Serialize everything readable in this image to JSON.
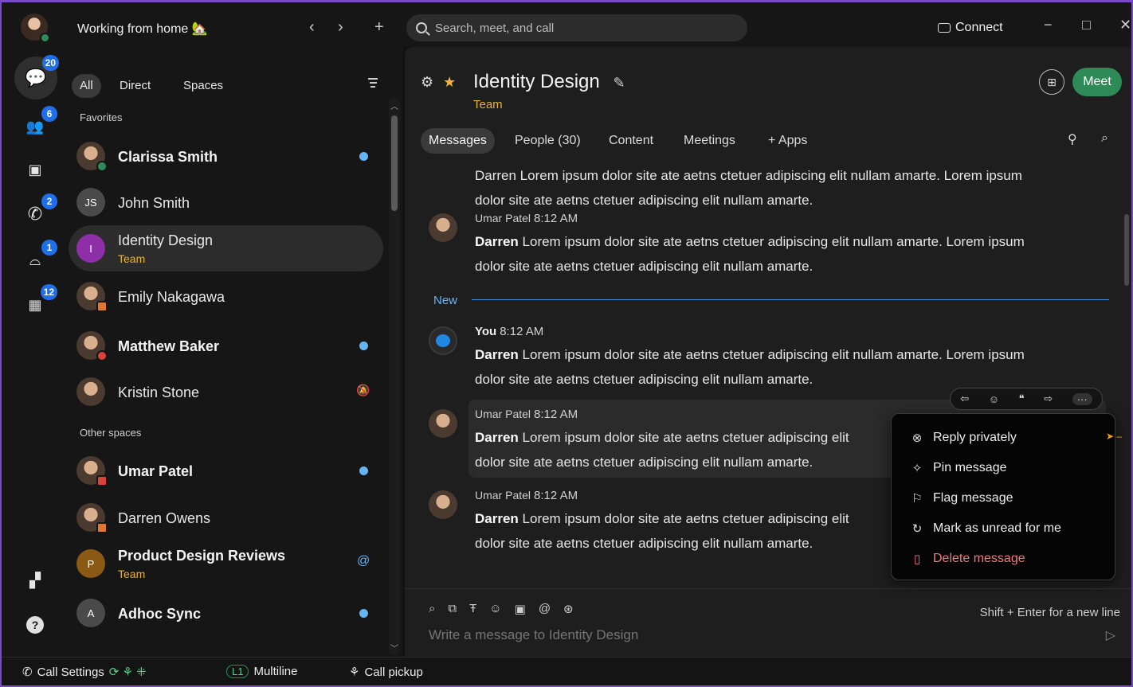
{
  "titlebar": {
    "status": "Working from home 🏡",
    "back": "‹",
    "forward": "›",
    "new": "+",
    "search_placeholder": "Search, meet, and call",
    "connect": "Connect",
    "minimize": "−",
    "maximize": "□",
    "close": "✕"
  },
  "rail": {
    "messaging_badge": "20",
    "teams_badge": "6",
    "calls_badge": "2",
    "voicemail_badge": "1",
    "meetings_badge": "12",
    "help": "?"
  },
  "list": {
    "filters": [
      "All",
      "Direct",
      "Spaces"
    ],
    "section_favorites": "Favorites",
    "section_other": "Other spaces",
    "items": [
      {
        "name": "Clarissa Smith",
        "initials": ""
      },
      {
        "name": "John Smith",
        "initials": "JS"
      },
      {
        "name": "Identity Design",
        "initials": "I",
        "sub": "Team"
      },
      {
        "name": "Emily Nakagawa",
        "initials": ""
      },
      {
        "name": "Matthew Baker",
        "initials": ""
      },
      {
        "name": "Kristin Stone",
        "initials": ""
      },
      {
        "name": "Umar Patel",
        "initials": ""
      },
      {
        "name": "Darren Owens",
        "initials": ""
      },
      {
        "name": "Product Design Reviews",
        "initials": "P",
        "sub": "Team"
      },
      {
        "name": "Adhoc Sync",
        "initials": "A"
      }
    ]
  },
  "space": {
    "title": "Identity Design",
    "subtitle": "Team",
    "meet": "Meet",
    "tabs": [
      "Messages",
      "People (30)",
      "Content",
      "Meetings",
      "+ Apps"
    ]
  },
  "messages": {
    "first_tail": "dolor site ate aetns ctetuer adipiscing elit nullam amarte.",
    "first_head": "Darren Lorem ipsum dolor site ate aetns ctetuer adipiscing elit nullam amarte. Lorem ipsum",
    "new_label": "New",
    "items": [
      {
        "sender": "Umar Patel",
        "time": "8:12 AM",
        "mention": "Darren",
        "line1": " Lorem ipsum dolor site ate aetns ctetuer adipiscing elit nullam amarte. Lorem ipsum",
        "line2": "dolor site ate aetns ctetuer adipiscing elit nullam amarte."
      },
      {
        "sender": "You",
        "time": "8:12 AM",
        "mention": "Darren",
        "line1": " Lorem ipsum dolor site ate aetns ctetuer adipiscing elit nullam amarte. Lorem ipsum",
        "line2": "dolor site ate aetns ctetuer adipiscing elit nullam amarte."
      },
      {
        "sender": "Umar Patel",
        "time": "8:12 AM",
        "mention": "Darren",
        "line1": " Lorem ipsum dolor site ate aetns ctetuer adipiscing elit",
        "line2": "dolor site ate aetns ctetuer adipiscing elit nullam amarte."
      },
      {
        "sender": "Umar Patel",
        "time": "8:12 AM",
        "mention": "Darren",
        "line1": " Lorem ipsum dolor site ate aetns ctetuer adipiscing elit",
        "line2": "dolor site ate aetns ctetuer adipiscing elit nullam amarte."
      }
    ]
  },
  "context_menu": {
    "items": [
      "Reply privately",
      "Pin message",
      "Flag message",
      "Mark as unread for me",
      "Delete message"
    ]
  },
  "composer": {
    "placeholder": "Write a message to Identity Design",
    "hint": "Shift + Enter for a new line"
  },
  "statusbar": {
    "call_settings": "Call Settings",
    "line": "L1",
    "multiline": "Multiline",
    "call_pickup": "Call pickup"
  },
  "colors": {
    "accent_green": "#2e8b57",
    "unread_blue": "#64b5f6",
    "team_yellow": "#e7b43a",
    "danger": "#f3787e",
    "frame_purple": "#7b4ac7"
  }
}
